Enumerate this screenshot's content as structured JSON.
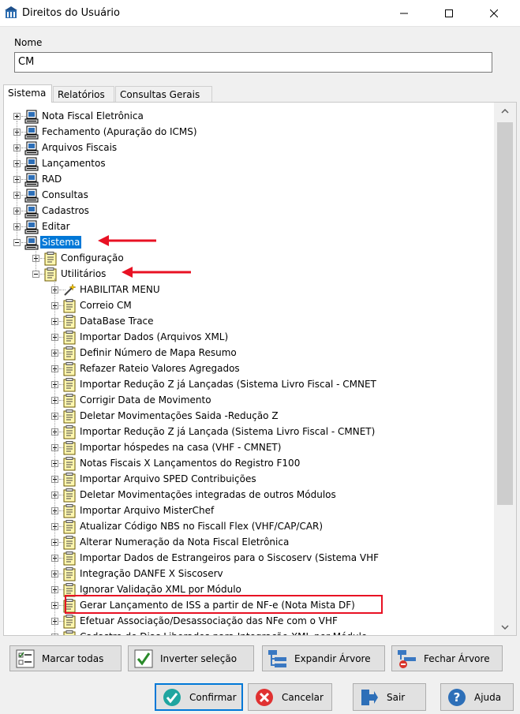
{
  "window": {
    "title": "Direitos do Usuário",
    "minimize": "minimize-icon",
    "maximize": "maximize-icon",
    "close": "close-icon"
  },
  "name_field": {
    "label": "Nome",
    "value": "CM"
  },
  "tabs": [
    "Sistema",
    "Relatórios",
    "Consultas Gerais"
  ],
  "active_tab": "Sistema",
  "tree": {
    "top_level": [
      "Nota Fiscal Eletrônica",
      "Fechamento (Apuração do ICMS)",
      "Arquivos Fiscais",
      "Lançamentos",
      "RAD",
      "Consultas",
      "Cadastros",
      "Editar",
      "Sistema"
    ],
    "selected": "Sistema",
    "sistema_children": [
      "Configuração",
      "Utilitários"
    ],
    "utilitarios_children": [
      "HABILITAR MENU",
      "Correio CM",
      "DataBase Trace",
      "Importar Dados (Arquivos XML)",
      "Definir Número de Mapa Resumo",
      "Refazer Rateio Valores Agregados",
      "Importar Redução Z já Lançadas (Sistema Livro Fiscal - CMNET",
      "Corrigir Data de Movimento",
      "Deletar Movimentações Saida -Redução Z",
      "Importar Redução Z já Lançada (Sistema Livro Fiscal - CMNET)",
      "Importar hóspedes na casa (VHF - CMNET)",
      "Notas Fiscais X Lançamentos do Registro F100",
      "Importar Arquivo SPED Contribuições",
      "Deletar Movimentações integradas de outros Módulos",
      "Importar Arquivo MisterChef",
      "Atualizar Código NBS no Fiscall Flex (VHF/CAP/CAR)",
      "Alterar Numeração da Nota Fiscal Eletrônica",
      "Importar Dados de Estrangeiros para o Siscoserv (Sistema VHF",
      "Integração DANFE X Siscoserv",
      "Ignorar Validação XML por Módulo",
      "Gerar Lançamento de ISS a partir de NF-e  (Nota Mista DF)",
      "Efetuar Associação/Desassociação das NFe com o VHF",
      "Cadastro de Dias Liberados para Integração XML por Módulo"
    ]
  },
  "tree_buttons": {
    "marcar": "Marcar todas",
    "inverter": "Inverter seleção",
    "expandir": "Expandir Árvore",
    "fechar": "Fechar Árvore"
  },
  "dialog_buttons": {
    "confirmar": "Confirmar",
    "cancelar": "Cancelar",
    "sair": "Sair",
    "ajuda": "Ajuda"
  },
  "colors": {
    "selection": "#0078d7",
    "annotation": "#e81123"
  }
}
